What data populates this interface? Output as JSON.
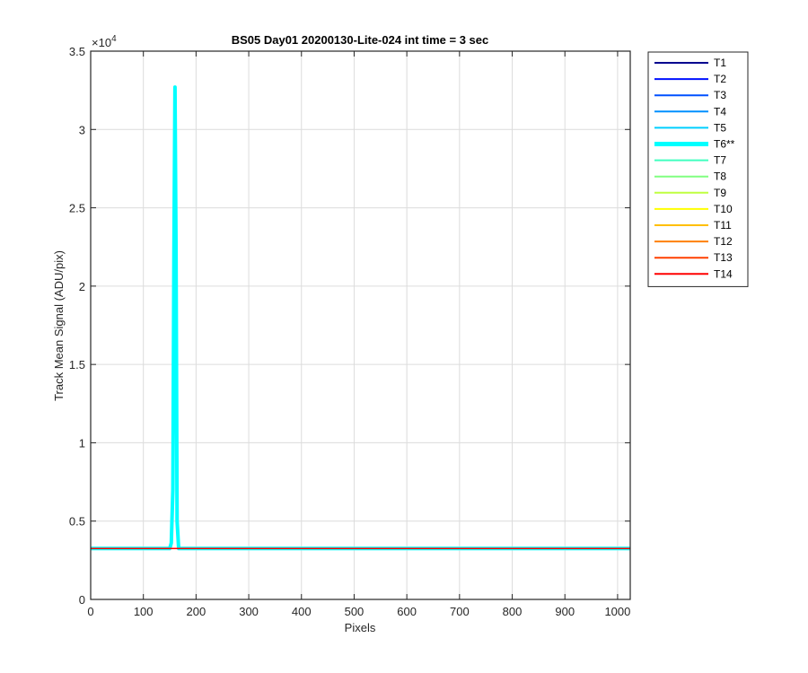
{
  "chart_data": {
    "type": "line",
    "title": "BS05 Day01 20200130-Lite-024 int time = 3 sec",
    "xlabel": "Pixels",
    "ylabel": "Track Mean Signal (ADU/pix)",
    "y_exponent_label": "×10",
    "y_exponent": "4",
    "xlim": [
      0,
      1024
    ],
    "ylim": [
      0,
      35000
    ],
    "xticks": [
      0,
      100,
      200,
      300,
      400,
      500,
      600,
      700,
      800,
      900,
      1000
    ],
    "xtick_labels": [
      "0",
      "100",
      "200",
      "300",
      "400",
      "500",
      "600",
      "700",
      "800",
      "900",
      "1000"
    ],
    "yticks": [
      0,
      5000,
      10000,
      15000,
      20000,
      25000,
      30000,
      35000
    ],
    "ytick_labels": [
      "0",
      "0.5",
      "1",
      "1.5",
      "2",
      "2.5",
      "3",
      "3.5"
    ],
    "grid": true,
    "legend_position": "outside-top-right",
    "baseline_value": 3250,
    "series": [
      {
        "name": "T1",
        "color": "#00008f",
        "baseline": 3250
      },
      {
        "name": "T2",
        "color": "#0010ff",
        "baseline": 3250
      },
      {
        "name": "T3",
        "color": "#0050ff",
        "baseline": 3250
      },
      {
        "name": "T4",
        "color": "#0090ff",
        "baseline": 3250
      },
      {
        "name": "T5",
        "color": "#00cfff",
        "baseline": 3250
      },
      {
        "name": "T6**",
        "color": "#00ffff",
        "baseline": 3250,
        "highlight": true,
        "peak": {
          "x": [
            150,
            153,
            156,
            158,
            160,
            162,
            164,
            167
          ],
          "y": [
            3250,
            3600,
            7000,
            22000,
            32700,
            22000,
            5000,
            3250
          ]
        }
      },
      {
        "name": "T7",
        "color": "#40ffbf",
        "baseline": 3250
      },
      {
        "name": "T8",
        "color": "#80ff80",
        "baseline": 3250
      },
      {
        "name": "T9",
        "color": "#bfff40",
        "baseline": 3250
      },
      {
        "name": "T10",
        "color": "#ffff00",
        "baseline": 3250
      },
      {
        "name": "T11",
        "color": "#ffbf00",
        "baseline": 3250
      },
      {
        "name": "T12",
        "color": "#ff8000",
        "baseline": 3250
      },
      {
        "name": "T13",
        "color": "#ff4000",
        "baseline": 3250
      },
      {
        "name": "T14",
        "color": "#ff0000",
        "baseline": 3250
      }
    ]
  }
}
